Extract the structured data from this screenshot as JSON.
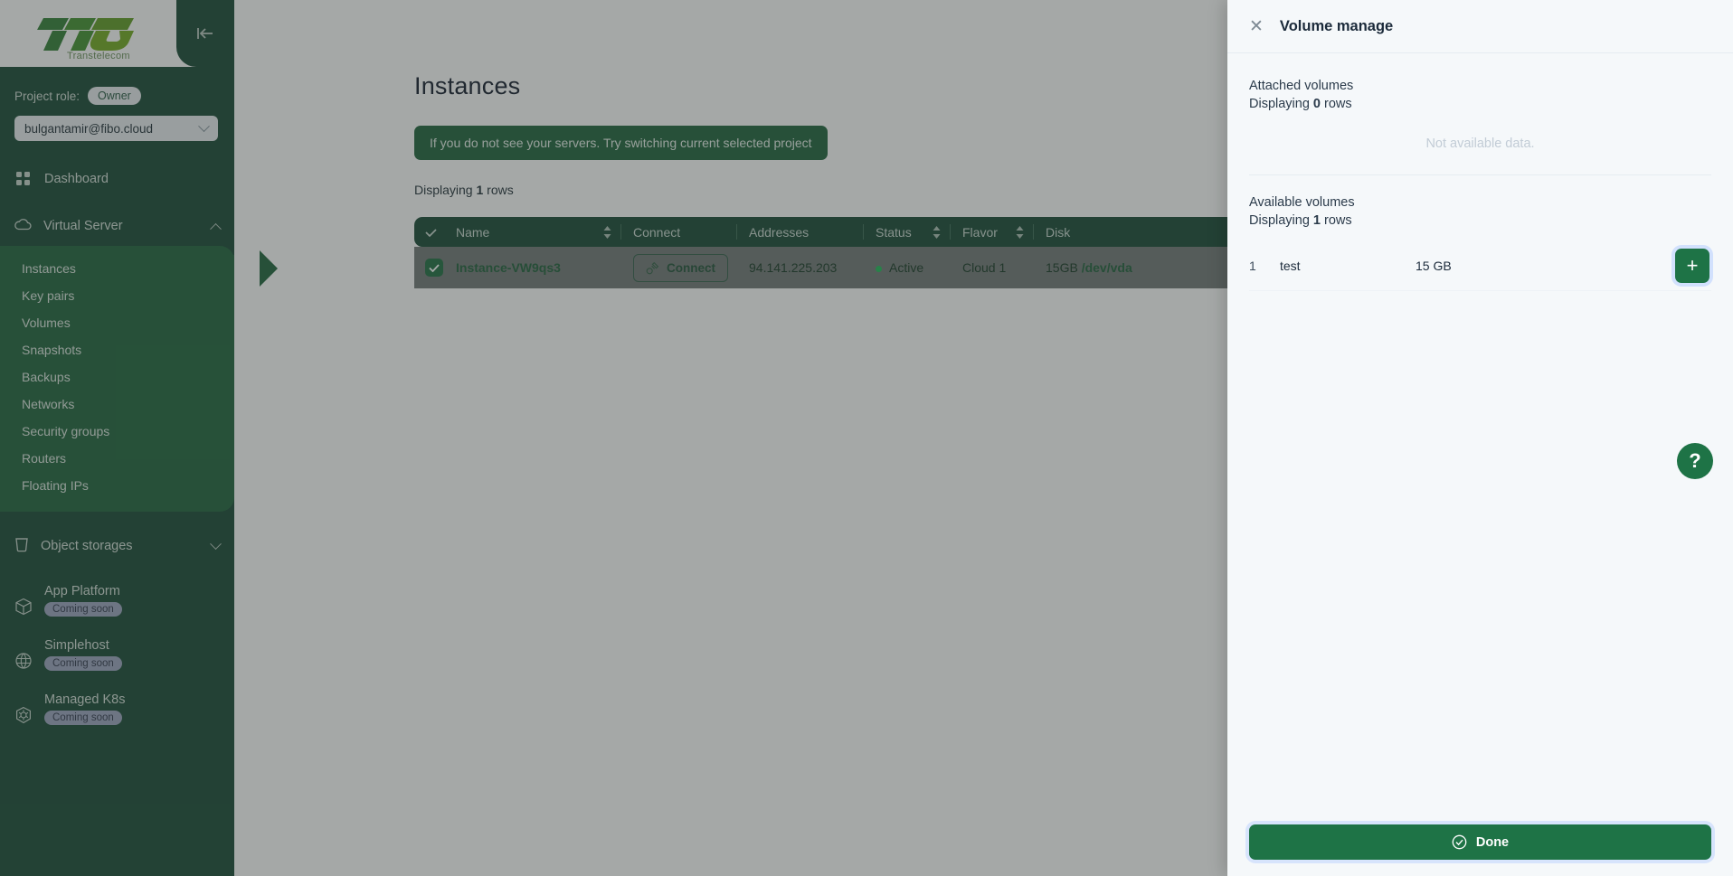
{
  "brand": {
    "logo_text": "TTC",
    "logo_sub": "Transtelecom"
  },
  "sidebar": {
    "collapse_label": "|←",
    "project_role_label": "Project role:",
    "project_role_value": "Owner",
    "project_selected": "bulgantamir@fibo.cloud",
    "dashboard": {
      "label": "Dashboard",
      "icon": "grid-icon"
    },
    "virtual_server": {
      "label": "Virtual Server",
      "icon": "cloud-icon"
    },
    "virtual_server_items": [
      {
        "label": "Instances",
        "active": true
      },
      {
        "label": "Key pairs",
        "active": false
      },
      {
        "label": "Volumes",
        "active": false
      },
      {
        "label": "Snapshots",
        "active": false
      },
      {
        "label": "Backups",
        "active": false
      },
      {
        "label": "Networks",
        "active": false
      },
      {
        "label": "Security groups",
        "active": false
      },
      {
        "label": "Routers",
        "active": false
      },
      {
        "label": "Floating IPs",
        "active": false
      }
    ],
    "object_storages": {
      "label": "Object storages",
      "icon": "bucket-icon"
    },
    "coming_soon_items": [
      {
        "label": "App Platform",
        "badge": "Coming soon",
        "icon": "cube-icon"
      },
      {
        "label": "Simplehost",
        "badge": "Coming soon",
        "icon": "globe-icon"
      },
      {
        "label": "Managed K8s",
        "badge": "Coming soon",
        "icon": "kubernetes-icon"
      }
    ]
  },
  "main": {
    "page_title": "Instances",
    "banner": "If you do not see your servers. Try switching current selected project",
    "rows_prefix": "Displaying ",
    "rows_count": "1",
    "rows_suffix": " rows",
    "columns": [
      "Name",
      "Connect",
      "Addresses",
      "Status",
      "Flavor",
      "Disk"
    ],
    "row": {
      "name": "Instance-VW9qs3",
      "connect_label": "Connect",
      "address": "94.141.225.203",
      "status": "Active",
      "flavor": "Cloud 1",
      "disk_size": "15GB",
      "disk_dev": "/dev/vda"
    }
  },
  "drawer": {
    "title": "Volume manage",
    "close_label": "✕",
    "attached": {
      "title": "Attached volumes",
      "rows_prefix": "Displaying ",
      "rows_count": "0",
      "rows_suffix": " rows",
      "empty_text": "Not available data."
    },
    "available": {
      "title": "Available volumes",
      "rows_prefix": "Displaying ",
      "rows_count": "1",
      "rows_suffix": " rows",
      "rows": [
        {
          "index": "1",
          "name": "test",
          "size": "15 GB",
          "add_label": "+"
        }
      ]
    },
    "done_label": "Done"
  },
  "help": {
    "label": "?"
  },
  "colors": {
    "sidebar_bg": "#134430",
    "subnav_bg": "#1a6037",
    "accent_green": "#1e7346",
    "status_green": "#1db954",
    "drawer_bg": "#f5f8fa"
  }
}
